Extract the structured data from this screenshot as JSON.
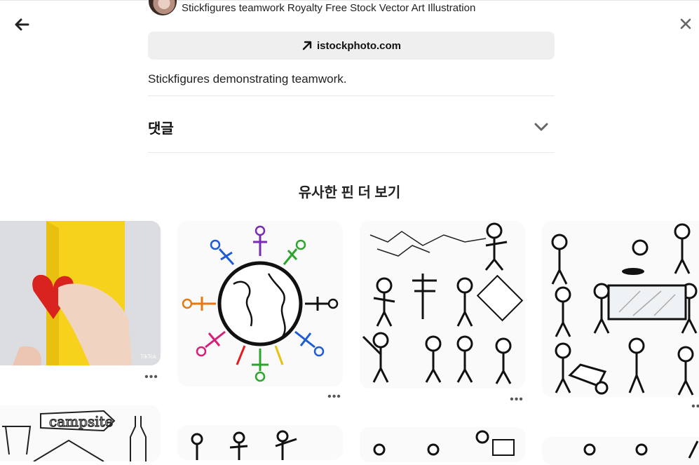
{
  "source": {
    "title": "Stickfigures teamwork Royalty Free Stock Vector Art Illustration"
  },
  "visit": {
    "label": "istockphoto.com",
    "icon": "arrow-up-right-icon"
  },
  "description": "Stickfigures demonstrating teamwork.",
  "comments": {
    "label": "댓글",
    "icon": "chevron-down-icon"
  },
  "more": {
    "title": "유사한 핀 더 보기"
  },
  "pins": [
    {
      "name": "popup heart card",
      "badge": "TikTok"
    },
    {
      "name": "stickfigures around globe"
    },
    {
      "name": "stickfigures strategy direction"
    },
    {
      "name": "stickfigures construction workers"
    },
    {
      "name": "campsite sketch"
    },
    {
      "name": "stickfigures climbing"
    },
    {
      "name": "stickfigures office"
    },
    {
      "name": "stickfigure partial"
    }
  ],
  "pin_menu_glyph": "•••",
  "colors": {
    "button_bg": "#efefef",
    "text": "#111111",
    "card_yellow": "#f7d21c",
    "heart": "#d8231f"
  }
}
